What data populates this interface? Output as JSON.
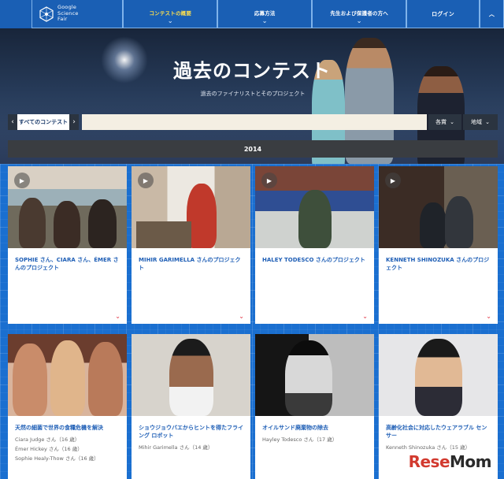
{
  "nav": {
    "logo_line1": "Google",
    "logo_line2": "Science",
    "logo_line3": "Fair",
    "items": [
      {
        "label": "コンテストの概要"
      },
      {
        "label": "応募方法"
      },
      {
        "label": "先生および保護者の方へ"
      }
    ],
    "login": "ログイン",
    "up": "︿"
  },
  "hero": {
    "title": "過去のコンテスト",
    "subtitle": "過去のファイナリストとそのプロジェクト"
  },
  "filter": {
    "prev": "‹",
    "contest": "すべてのコンテスト",
    "next": "›",
    "search_placeholder": "",
    "award": "各賞",
    "region": "地域"
  },
  "year": "2014",
  "row1": [
    {
      "title": "SOPHIE さん、CIARA さん、ÉMER さんのプロジェクト"
    },
    {
      "title": "MIHIR GARIMELLA さんのプロジェクト"
    },
    {
      "title": "HALEY TODESCO さんのプロジェクト"
    },
    {
      "title": "KENNETH SHINOZUKA さんのプロジェクト"
    }
  ],
  "row2": [
    {
      "title": "天然の細菌で世界の食糧危機を解決",
      "people": [
        "Ciara Judge さん（16 歳）",
        "Émer Hickey さん（16 歳）",
        "Sophie Healy-Thow さん（16 歳）"
      ]
    },
    {
      "title": "ショウジョウバエからヒントを得たフライング ロボット",
      "people": [
        "Mihir Garimella さん（14 歳）"
      ]
    },
    {
      "title": "オイルサンド廃棄物の除去",
      "people": [
        "Hayley Todesco さん（17 歳）"
      ]
    },
    {
      "title": "高齢化社会に対応したウェアラブル センサー",
      "people": [
        "Kenneth Shinozuka さん（15 歳）"
      ]
    }
  ],
  "watermark": {
    "prefix": "Rese",
    "suffix": "Mom"
  }
}
